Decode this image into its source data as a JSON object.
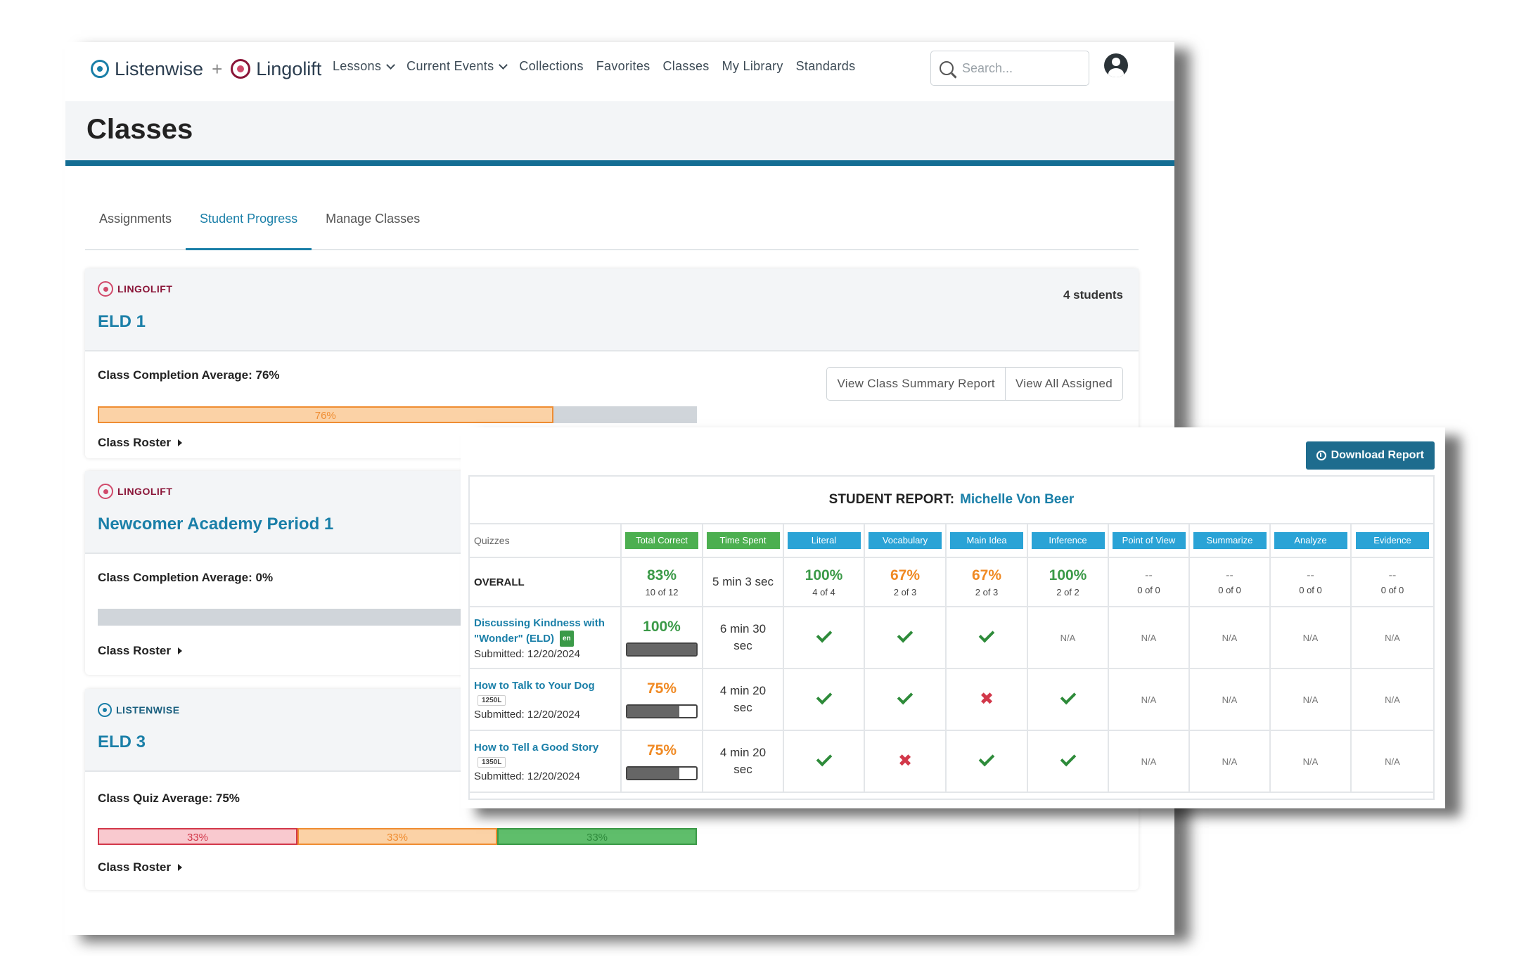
{
  "brand": {
    "listenwise": "Listenwise",
    "plus": "+",
    "lingolift": "Lingolift"
  },
  "nav": {
    "items": [
      {
        "label": "Lessons",
        "dropdown": true
      },
      {
        "label": "Current Events",
        "dropdown": true
      },
      {
        "label": "Collections",
        "dropdown": false
      },
      {
        "label": "Favorites",
        "dropdown": false
      },
      {
        "label": "Classes",
        "dropdown": false
      },
      {
        "label": "My Library",
        "dropdown": false
      },
      {
        "label": "Standards",
        "dropdown": false
      }
    ],
    "search_placeholder": "Search..."
  },
  "page": {
    "title": "Classes"
  },
  "tabs": [
    {
      "label": "Assignments",
      "active": false
    },
    {
      "label": "Student Progress",
      "active": true
    },
    {
      "label": "Manage Classes",
      "active": false
    }
  ],
  "classes": [
    {
      "provider": "LINGOLIFT",
      "name": "ELD 1",
      "students": "4 students",
      "average_label": "Class Completion Average: 76%",
      "bar_label": "76%",
      "completion": 76,
      "summary_button": "View Class Summary Report",
      "assigned_button": "View All Assigned",
      "roster": "Class Roster"
    },
    {
      "provider": "LINGOLIFT",
      "name": "Newcomer Academy Period 1",
      "average_label": "Class Completion Average: 0%",
      "completion": 0,
      "roster": "Class Roster"
    },
    {
      "provider": "LISTENWISE",
      "name": "ELD 3",
      "average_label": "Class Quiz Average: 75%",
      "segments": [
        "33%",
        "33%",
        "33%"
      ],
      "roster": "Class Roster"
    }
  ],
  "report": {
    "download_label": "Download Report",
    "title_prefix": "STUDENT REPORT:",
    "student_name": "Michelle Von Beer",
    "quizzes_header": "Quizzes",
    "columns": [
      "Total Correct",
      "Time Spent",
      "Literal",
      "Vocabulary",
      "Main Idea",
      "Inference",
      "Point of View",
      "Summarize",
      "Analyze",
      "Evidence"
    ],
    "overall": {
      "label": "OVERALL",
      "total": {
        "pct": "83%",
        "sub": "10 of 12"
      },
      "time": "5 min 3 sec",
      "skills": [
        {
          "pct": "100%",
          "sub": "4 of 4"
        },
        {
          "pct": "67%",
          "sub": "2 of 3"
        },
        {
          "pct": "67%",
          "sub": "2 of 3"
        },
        {
          "pct": "100%",
          "sub": "2 of 2"
        },
        {
          "pct": "--",
          "sub": "0 of 0"
        },
        {
          "pct": "--",
          "sub": "0 of 0"
        },
        {
          "pct": "--",
          "sub": "0 of 0"
        },
        {
          "pct": "--",
          "sub": "0 of 0"
        }
      ]
    },
    "rows": [
      {
        "title_1": "Discussing Kindness with",
        "title_2": "\"Wonder\" (ELD)",
        "badge": "en",
        "submitted": "Submitted: 12/20/2024",
        "total": "100%",
        "progress": 1.0,
        "time_1": "6 min 30",
        "time_2": "sec",
        "marks": [
          "check",
          "check",
          "check",
          "N/A",
          "N/A",
          "N/A",
          "N/A",
          "N/A"
        ]
      },
      {
        "title_1": "How to Talk to Your Dog",
        "lexile": "1250L",
        "submitted": "Submitted: 12/20/2024",
        "total": "75%",
        "progress": 0.75,
        "time_1": "4 min 20",
        "time_2": "sec",
        "marks": [
          "check",
          "check",
          "cross",
          "check",
          "N/A",
          "N/A",
          "N/A",
          "N/A"
        ]
      },
      {
        "title_1": "How to Tell a Good Story",
        "lexile": "1350L",
        "submitted": "Submitted: 12/20/2024",
        "total": "75%",
        "progress": 0.75,
        "time_1": "4 min 20",
        "time_2": "sec",
        "marks": [
          "check",
          "cross",
          "check",
          "check",
          "N/A",
          "N/A",
          "N/A",
          "N/A"
        ]
      }
    ]
  }
}
